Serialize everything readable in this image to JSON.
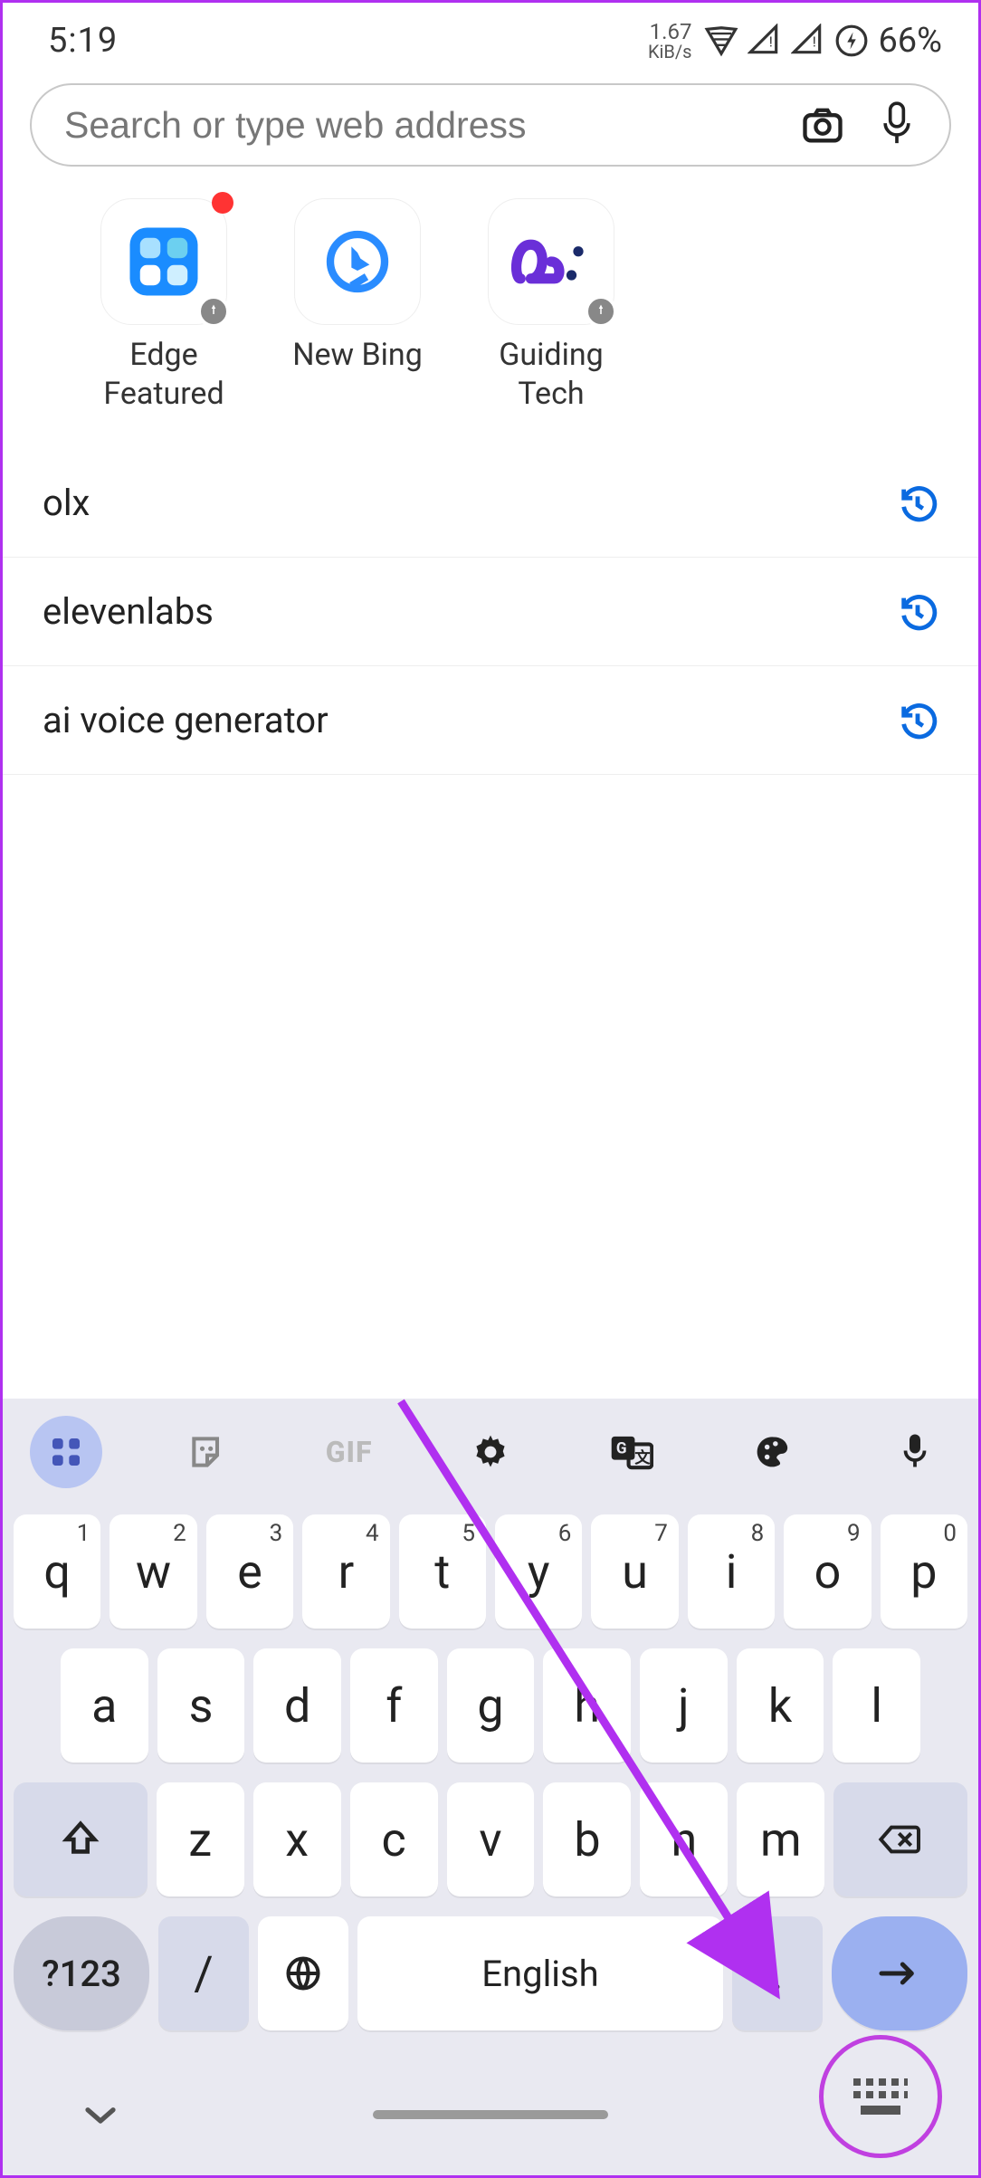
{
  "status": {
    "time": "5:19",
    "net_rate_top": "1.67",
    "net_rate_unit": "KiB/s",
    "battery_pct": "66%"
  },
  "search": {
    "placeholder": "Search or type web address"
  },
  "tiles": [
    {
      "label": "Edge Featured"
    },
    {
      "label": "New Bing"
    },
    {
      "label": "Guiding Tech"
    }
  ],
  "suggestions": [
    {
      "text": "olx"
    },
    {
      "text": "elevenlabs"
    },
    {
      "text": "ai voice generator"
    }
  ],
  "keyboard": {
    "gif_label": "GIF",
    "row1": [
      {
        "k": "q",
        "n": "1"
      },
      {
        "k": "w",
        "n": "2"
      },
      {
        "k": "e",
        "n": "3"
      },
      {
        "k": "r",
        "n": "4"
      },
      {
        "k": "t",
        "n": "5"
      },
      {
        "k": "y",
        "n": "6"
      },
      {
        "k": "u",
        "n": "7"
      },
      {
        "k": "i",
        "n": "8"
      },
      {
        "k": "o",
        "n": "9"
      },
      {
        "k": "p",
        "n": "0"
      }
    ],
    "row2": [
      "a",
      "s",
      "d",
      "f",
      "g",
      "h",
      "j",
      "k",
      "l"
    ],
    "row3": [
      "z",
      "x",
      "c",
      "v",
      "b",
      "n",
      "m"
    ],
    "sym_label": "?123",
    "slash_label": "/",
    "space_label": "English"
  }
}
